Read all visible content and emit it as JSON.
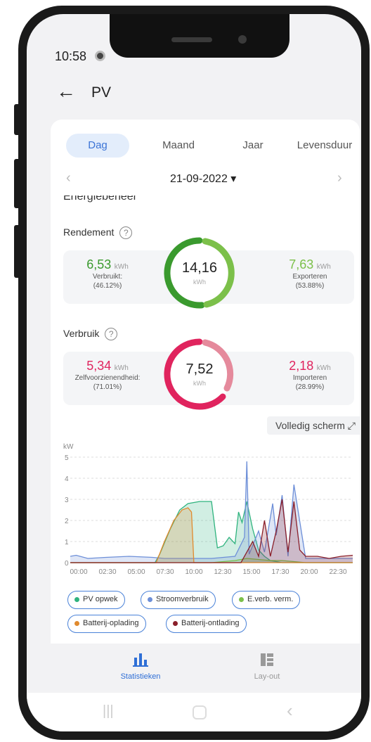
{
  "status": {
    "time": "10:58"
  },
  "header": {
    "title": "PV"
  },
  "tabs": [
    {
      "label": "Dag",
      "active": true
    },
    {
      "label": "Maand",
      "active": false
    },
    {
      "label": "Jaar",
      "active": false
    },
    {
      "label": "Levensduur",
      "active": false
    }
  ],
  "date": {
    "value": "21-09-2022 ▾"
  },
  "section_heading": "Energiebeheer",
  "rendement": {
    "label": "Rendement",
    "left": {
      "value": "6,53",
      "unit": "kWh",
      "label": "Verbruikt:",
      "percent": "(46.12%)"
    },
    "center": {
      "value": "14,16",
      "unit": "kWh"
    },
    "right": {
      "value": "7,63",
      "unit": "kWh",
      "label": "Exporteren",
      "percent": "(53.88%)"
    },
    "colors": {
      "left": "#3a9a2e",
      "right": "#7cc04a"
    }
  },
  "verbruik": {
    "label": "Verbruik",
    "left": {
      "value": "5,34",
      "unit": "kWh",
      "label": "Zelfvoorzienendheid:",
      "percent": "(71.01%)"
    },
    "center": {
      "value": "7,52",
      "unit": "kWh"
    },
    "right": {
      "value": "2,18",
      "unit": "kWh",
      "label": "Importeren",
      "percent": "(28.99%)"
    },
    "colors": {
      "left": "#e0245e",
      "right": "#e58a9c"
    }
  },
  "fullscreen_label": "Volledig scherm ⤢",
  "chart_data": {
    "type": "line",
    "ylabel": "kW",
    "ylim": [
      0,
      5
    ],
    "yticks": [
      "0",
      "1",
      "2",
      "3",
      "4",
      "5"
    ],
    "xticks": [
      "00:00",
      "02:30",
      "05:00",
      "07:30",
      "10:00",
      "12:30",
      "15:00",
      "17:30",
      "20:00",
      "22:30"
    ],
    "grid": true,
    "series": [
      {
        "name": "PV opwek",
        "color": "#2fb37e",
        "x": [
          0,
          7.2,
          7.6,
          8.5,
          9.3,
          10.0,
          11.0,
          12.0,
          12.5,
          13.0,
          13.5,
          14.0,
          14.3,
          14.6,
          15.0,
          15.5,
          16.0,
          16.5,
          17.0,
          18.0,
          24
        ],
        "y": [
          0,
          0,
          0.4,
          1.6,
          2.5,
          2.8,
          2.9,
          2.9,
          0.7,
          0.8,
          1.2,
          0.9,
          2.4,
          1.9,
          2.9,
          1.6,
          0.6,
          0.3,
          0.1,
          0,
          0
        ]
      },
      {
        "name": "Stroomverbruik",
        "color": "#6d8fd8",
        "x": [
          0,
          0.5,
          1.5,
          3,
          5,
          7,
          8,
          10,
          12,
          14,
          14.8,
          15.0,
          15.2,
          16,
          16.5,
          17.2,
          17.5,
          18,
          18.5,
          19,
          20,
          22,
          24
        ],
        "y": [
          0.3,
          0.35,
          0.2,
          0.25,
          0.3,
          0.25,
          0.2,
          0.2,
          0.2,
          0.3,
          1.2,
          4.8,
          0.4,
          1.5,
          0.5,
          2.8,
          1.3,
          3.2,
          0.3,
          3.7,
          0.2,
          0.2,
          0.2
        ]
      },
      {
        "name": "E.verb. verm.",
        "color": "#7cc04a",
        "x": [
          0,
          12,
          13,
          14,
          15,
          16,
          17,
          18,
          19,
          20,
          24
        ],
        "y": [
          0,
          0,
          0.05,
          0.1,
          0.2,
          0.15,
          0.1,
          0.1,
          0.05,
          0,
          0
        ]
      },
      {
        "name": "Batterij-oplading",
        "color": "#e08a2e",
        "x": [
          0,
          7.3,
          8.0,
          8.8,
          9.5,
          10.0,
          10.3,
          10.5,
          24
        ],
        "y": [
          0,
          0,
          1.0,
          2.0,
          2.5,
          2.6,
          2.4,
          0,
          0
        ]
      },
      {
        "name": "Batterij-ontlading",
        "color": "#8a1f2a",
        "x": [
          0,
          14.5,
          15.5,
          16.0,
          16.5,
          17.0,
          17.5,
          18.0,
          18.5,
          19.0,
          19.5,
          20.0,
          21,
          22,
          23,
          24
        ],
        "y": [
          0,
          0,
          1.0,
          0.3,
          2.0,
          0.3,
          1.5,
          3.0,
          0.5,
          2.9,
          0.6,
          0.3,
          0.3,
          0.2,
          0.3,
          0.35
        ]
      }
    ]
  },
  "legend": [
    {
      "label": "PV opwek",
      "color": "#2fb37e"
    },
    {
      "label": "Stroomverbruik",
      "color": "#6d8fd8"
    },
    {
      "label": "E.verb. verm.",
      "color": "#7cc04a"
    },
    {
      "label": "Batterij-oplading",
      "color": "#e08a2e"
    },
    {
      "label": "Batterij-ontlading",
      "color": "#8a1f2a"
    }
  ],
  "bottom_nav": [
    {
      "label": "Statistieken",
      "icon": "bar-chart-icon",
      "active": true,
      "color": "#2f6fd6"
    },
    {
      "label": "Lay-out",
      "icon": "layout-icon",
      "active": false,
      "color": "#999999"
    }
  ]
}
